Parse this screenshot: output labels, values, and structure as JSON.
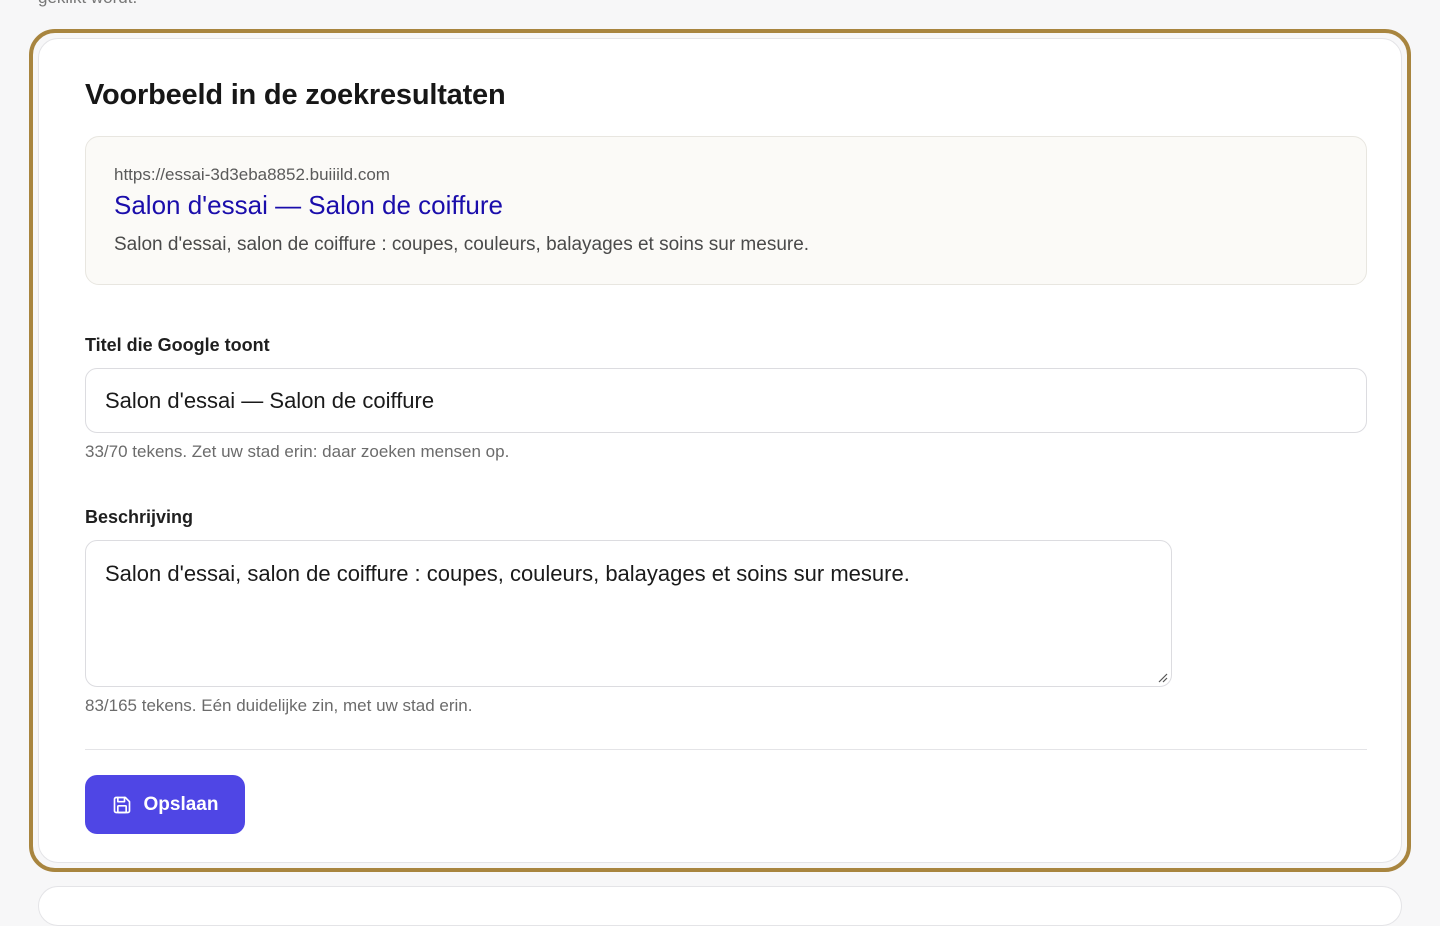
{
  "page": {
    "top_clipped_text": "gekiikt wordt."
  },
  "seo_card": {
    "title": "Voorbeeld in de zoekresultaten",
    "preview": {
      "url": "https://essai-3d3eba8852.buiiild.com",
      "title": "Salon d'essai — Salon de coiffure",
      "description": "Salon d'essai, salon de coiffure : coupes, couleurs, balayages et soins sur mesure."
    },
    "title_field": {
      "label": "Titel die Google toont",
      "value": "Salon d'essai — Salon de coiffure",
      "help": "33/70 tekens. Zet uw stad erin: daar zoeken mensen op."
    },
    "description_field": {
      "label": "Beschrijving",
      "value": "Salon d'essai, salon de coiffure : coupes, couleurs, balayages et soins sur mesure.",
      "help": "83/165 tekens. Eén duidelijke zin, met uw stad erin."
    },
    "save_button": {
      "label": "Opslaan",
      "icon": "save-icon"
    }
  },
  "colors": {
    "frame_border": "#a8853f",
    "primary": "#4f46e5",
    "link_blue": "#1a0dab"
  }
}
